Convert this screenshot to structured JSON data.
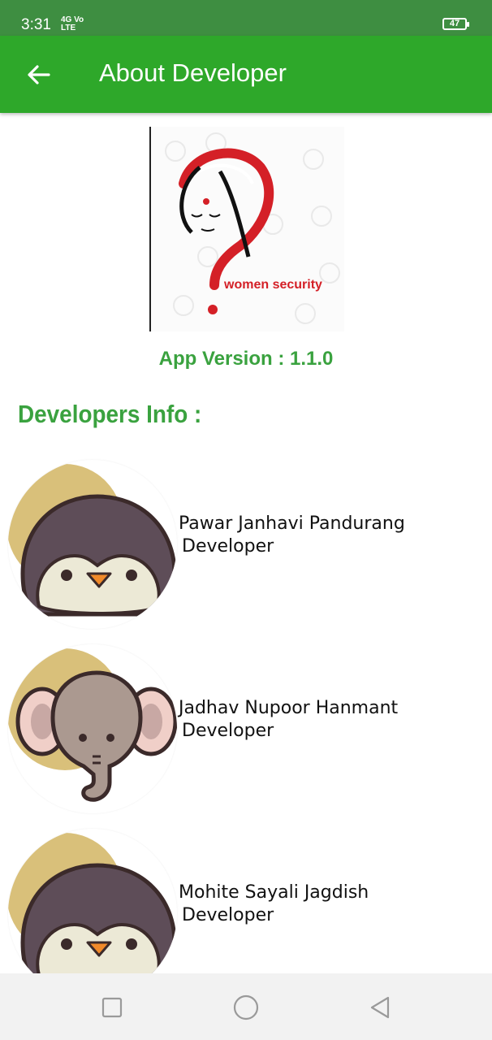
{
  "status_bar": {
    "time": "3:31",
    "network_top": "4G Vo",
    "network_bottom": "LTE",
    "battery": "47"
  },
  "header": {
    "title": "About Developer",
    "back_icon": "arrow-back-icon"
  },
  "logo": {
    "text": "women security"
  },
  "version_text": "App Version : 1.1.0",
  "developers_heading": "Developers Info :",
  "developers": [
    {
      "name": "Pawar Janhavi Pandurang",
      "role": "Developer",
      "avatar": "penguin-icon"
    },
    {
      "name": "Jadhav Nupoor Hanmant",
      "role": "Developer",
      "avatar": "elephant-icon"
    },
    {
      "name": "Mohite Sayali Jagdish",
      "role": "Developer",
      "avatar": "penguin-icon"
    }
  ],
  "nav": {
    "recent": "square-icon",
    "home": "circle-icon",
    "back": "triangle-back-icon"
  },
  "colors": {
    "status_bar": "#3e8e41",
    "app_bar": "#2ea82a",
    "accent_green": "#3aa23f",
    "brand_red": "#d42027"
  }
}
